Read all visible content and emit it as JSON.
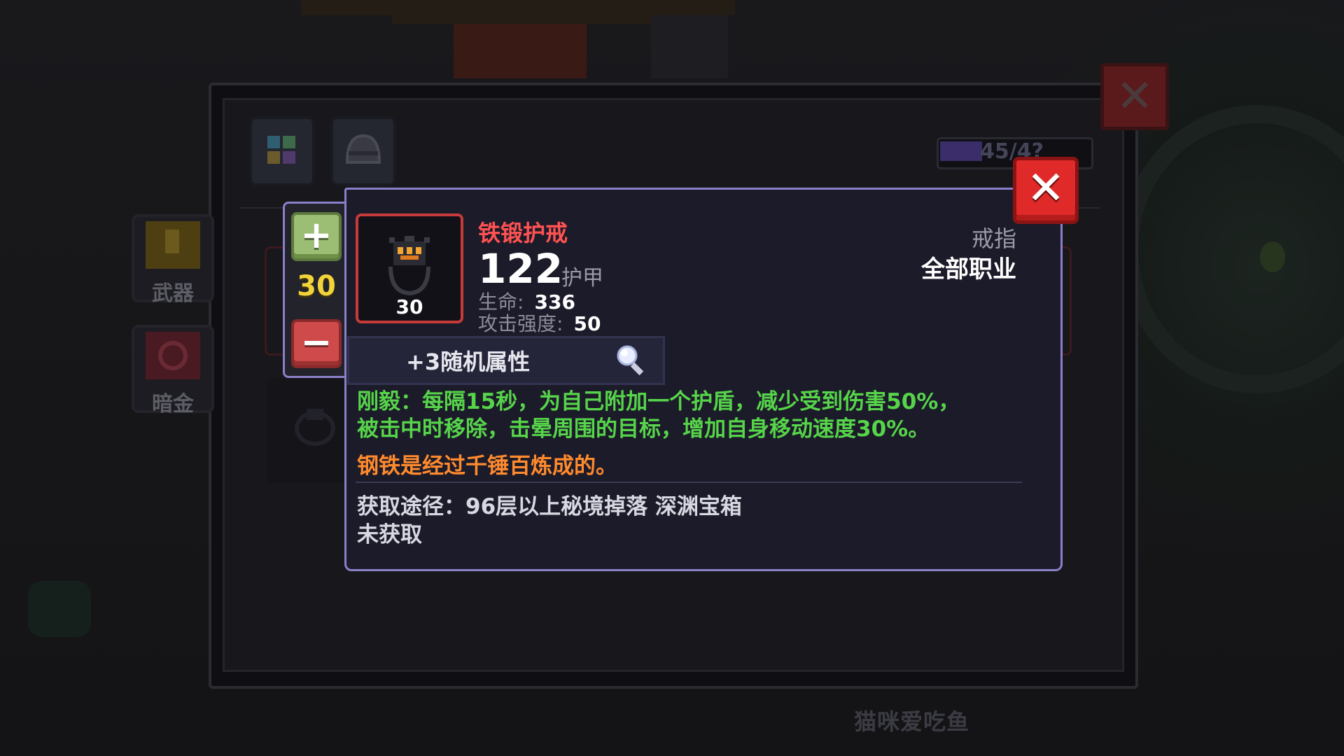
{
  "background": {
    "tabs": [
      {
        "icon": "item-grid-icon"
      },
      {
        "icon": "helmet-icon"
      }
    ],
    "sidebar": [
      {
        "label": "武器",
        "icon": "weapon-icon"
      },
      {
        "label": "暗金",
        "icon": "dark-gold-icon"
      }
    ],
    "capacity": "45/4?",
    "player_name": "猫咪爱吃鱼",
    "close_icon": "close-icon"
  },
  "stepper": {
    "quantity": "30",
    "plus_icon": "plus-icon",
    "minus_icon": "minus-icon"
  },
  "item": {
    "icon": "iron-ring-icon",
    "level": "30",
    "name": "铁锻护戒",
    "armor_value": "122",
    "armor_label": "护甲",
    "stats": [
      {
        "label": "生命:",
        "value": "336"
      },
      {
        "label": "攻击强度:",
        "value": "50"
      }
    ],
    "slot": "戒指",
    "class": "全部职业",
    "random_attr": "+3随机属性",
    "random_attr_icon": "magnifier-icon",
    "skill_lines": [
      "刚毅：每隔15秒，为自己附加一个护盾，减少受到伤害50%，",
      "被击中时移除，击晕周围的目标，增加自身移动速度30%。"
    ],
    "flavor": "钢铁是经过千锤百炼成的。",
    "source": "获取途径：96层以上秘境掉落 深渊宝箱",
    "status": "未获取"
  },
  "colors": {
    "name": "#ff5252",
    "skill": "#56d44a",
    "flavor": "#ff8a2e",
    "quantity": "#f2d43a",
    "card_border": "#8a80c9"
  }
}
